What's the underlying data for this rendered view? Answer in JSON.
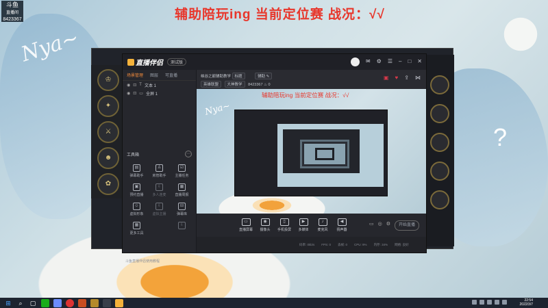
{
  "wallpaper": {
    "banner_text": "辅助陪玩ing 当前定位赛 战况：√√",
    "nya_text": "Nya~",
    "logo_text": "斗鱼",
    "logo_sub": "直播间",
    "room_id": "8423367"
  },
  "app": {
    "name": "直播伴侣",
    "version_badge": "测试版",
    "window_controls": [
      "消息",
      "设置",
      "菜单",
      "最小化",
      "最大化",
      "关闭"
    ]
  },
  "left_panel": {
    "tabs": [
      "场景管理",
      "图层",
      "可直播"
    ],
    "layers": [
      {
        "label": "文本 1"
      },
      {
        "label": "全屏 1"
      }
    ],
    "toolbox_title": "工具箱",
    "toolbox_more": "⋯",
    "tools": [
      {
        "label": "弹幕助手",
        "icon": "▤",
        "enabled": true
      },
      {
        "label": "房管助手",
        "icon": "♙",
        "enabled": true
      },
      {
        "label": "主播任务",
        "icon": "☑",
        "enabled": true
      },
      {
        "label": "预约直播",
        "icon": "▣",
        "enabled": true
      },
      {
        "label": "多人连麦",
        "icon": "⇩",
        "enabled": false
      },
      {
        "label": "直播周报",
        "icon": "▦",
        "enabled": true
      },
      {
        "label": "虚拟形象",
        "icon": "☺",
        "enabled": true
      },
      {
        "label": "虚拟主播",
        "icon": "⇩",
        "enabled": false
      },
      {
        "label": "弹幕库",
        "icon": "⊟",
        "enabled": true
      },
      {
        "label": "更多工具",
        "icon": "▦",
        "enabled": true
      },
      {
        "label": "",
        "icon": "",
        "enabled": false
      },
      {
        "label": "",
        "icon": "⇩",
        "enabled": false
      }
    ],
    "helper_link": "斗鱼直播伴侣使用教程"
  },
  "info_bar": {
    "room_title_label": "标题",
    "room_title": "峡谷之巅辅助教学",
    "edit_label": "修改",
    "category_label": "分区",
    "category": "辅助",
    "tags": [
      "英雄联盟",
      "大神教学"
    ],
    "room_label": "房间号",
    "room_id": "8423367",
    "hot_value": "0"
  },
  "preview": {
    "banner_text": "辅助陪玩ing 当前定位赛 战况：√√",
    "nya_text": "Nya~"
  },
  "controls": {
    "buttons": [
      {
        "label": "直播屏幕",
        "icon": "▭"
      },
      {
        "label": "摄像头",
        "icon": "◉"
      },
      {
        "label": "手机投屏",
        "icon": "▯"
      },
      {
        "label": "多媒体",
        "icon": "▶"
      },
      {
        "label": "麦克风",
        "icon": "♪"
      },
      {
        "label": "扬声器",
        "icon": "◀"
      }
    ],
    "start_live_label": "开始直播"
  },
  "status_bar": {
    "items": [
      "码率: 0kb/s",
      "FPS: 0",
      "丢帧: 0",
      "CPU: 9%",
      "内存: 34%",
      "网络: 良好"
    ]
  },
  "taskbar": {
    "time": "22:54",
    "date": "2022/3/7"
  },
  "colors": {
    "accent_red": "#e8362b",
    "accent_orange": "#f08a3c",
    "window_bg": "#25262c"
  }
}
